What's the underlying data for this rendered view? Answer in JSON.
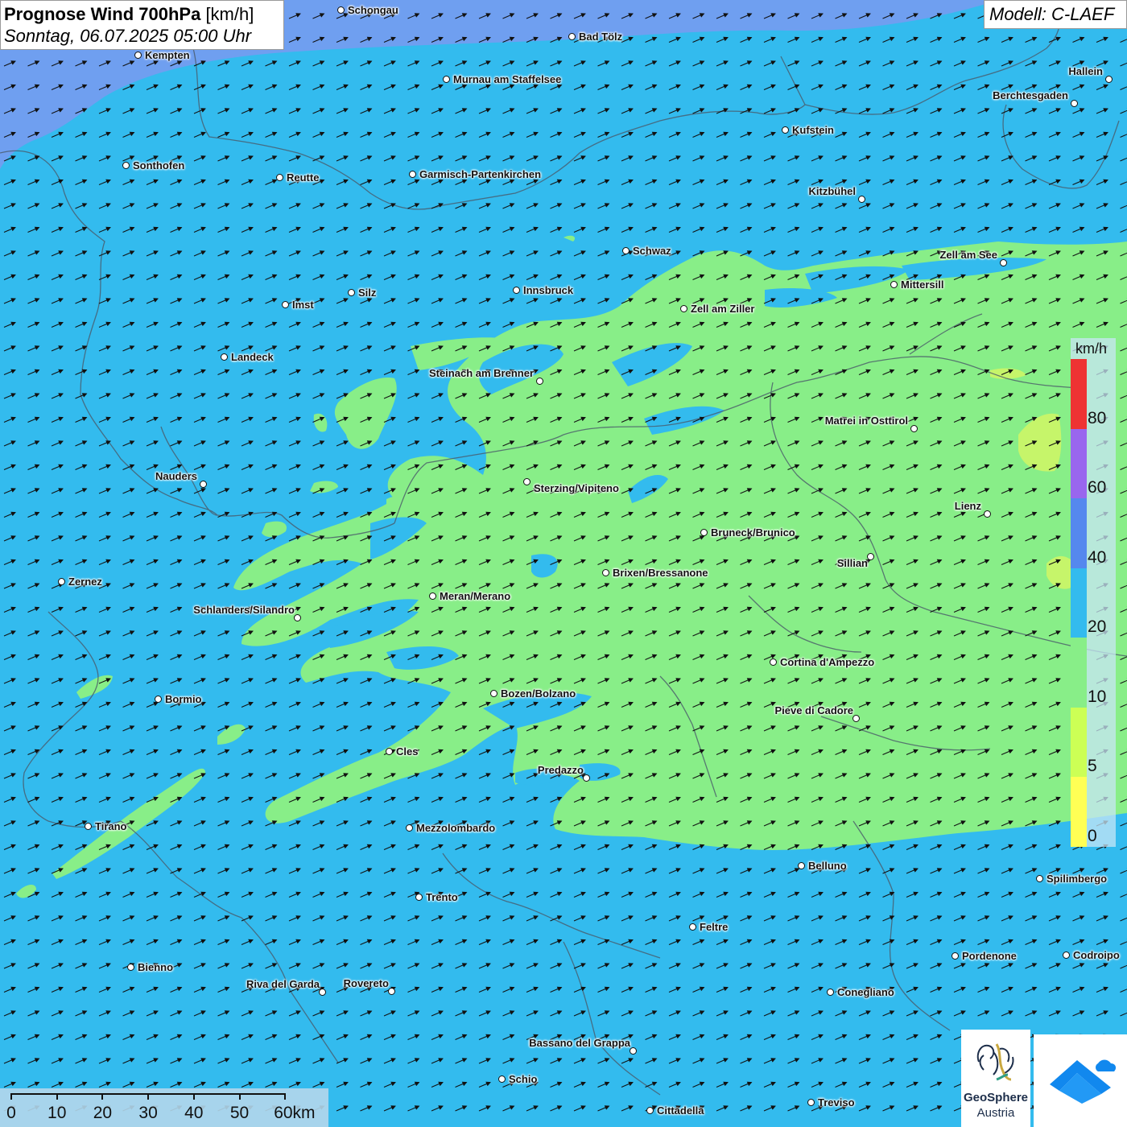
{
  "header": {
    "title_bold": "Prognose Wind 700hPa",
    "title_unit": "[km/h]",
    "datetime": "Sonntag, 06.07.2025 05:00 Uhr",
    "model": "Modell: C-LAEF"
  },
  "legend": {
    "unit": "km/h",
    "classes": [
      {
        "label": "80",
        "color": "#ee3333"
      },
      {
        "label": "60",
        "color": "#9966ee"
      },
      {
        "label": "40",
        "color": "#5588ee"
      },
      {
        "label": "20",
        "color": "#33bbee"
      },
      {
        "label": "10",
        "color": "#88ee88"
      },
      {
        "label": "5",
        "color": "#ccff55"
      },
      {
        "label": "0",
        "color": "#ffff55"
      }
    ]
  },
  "scale": {
    "labels": [
      "0",
      "10",
      "20",
      "30",
      "40",
      "50",
      "60km"
    ]
  },
  "logos": {
    "geosphere_line1": "GeoSphere",
    "geosphere_line2": "Austria"
  },
  "cities": [
    {
      "name": "Schongau"
    },
    {
      "name": "Bad Tölz"
    },
    {
      "name": "Kempten"
    },
    {
      "name": "Murnau am Staffelsee"
    },
    {
      "name": "Hallein"
    },
    {
      "name": "Berchtesgaden"
    },
    {
      "name": "Kufstein"
    },
    {
      "name": "Sonthofen"
    },
    {
      "name": "Reutte"
    },
    {
      "name": "Garmisch-Partenkirchen"
    },
    {
      "name": "Kitzbühel"
    },
    {
      "name": "Schwaz"
    },
    {
      "name": "Zell am See"
    },
    {
      "name": "Mittersill"
    },
    {
      "name": "Innsbruck"
    },
    {
      "name": "Silz"
    },
    {
      "name": "Imst"
    },
    {
      "name": "Zell am Ziller"
    },
    {
      "name": "Landeck"
    },
    {
      "name": "Steinach am Brenner"
    },
    {
      "name": "Matrei in Osttirol"
    },
    {
      "name": "Nauders"
    },
    {
      "name": "Sterzing/Vipiteno"
    },
    {
      "name": "Lienz"
    },
    {
      "name": "Bruneck/Brunico"
    },
    {
      "name": "Sillian"
    },
    {
      "name": "Zernez"
    },
    {
      "name": "Brixen/Bressanone"
    },
    {
      "name": "Meran/Merano"
    },
    {
      "name": "Schlanders/Silandro"
    },
    {
      "name": "Cortina d'Ampezzo"
    },
    {
      "name": "Bozen/Bolzano"
    },
    {
      "name": "Bormio"
    },
    {
      "name": "Pieve di Cadore"
    },
    {
      "name": "Cles"
    },
    {
      "name": "Predazzo"
    },
    {
      "name": "Tirano"
    },
    {
      "name": "Mezzolombardo"
    },
    {
      "name": "Belluno"
    },
    {
      "name": "Spilimbergo"
    },
    {
      "name": "Trento"
    },
    {
      "name": "Feltre"
    },
    {
      "name": "Bienno"
    },
    {
      "name": "Pordenone"
    },
    {
      "name": "Codroipo"
    },
    {
      "name": "Riva del Garda"
    },
    {
      "name": "Rovereto"
    },
    {
      "name": "Conegliano"
    },
    {
      "name": "Bassano del Grappa"
    },
    {
      "name": "Schio"
    },
    {
      "name": "Treviso"
    },
    {
      "name": "Cittadella"
    }
  ]
}
